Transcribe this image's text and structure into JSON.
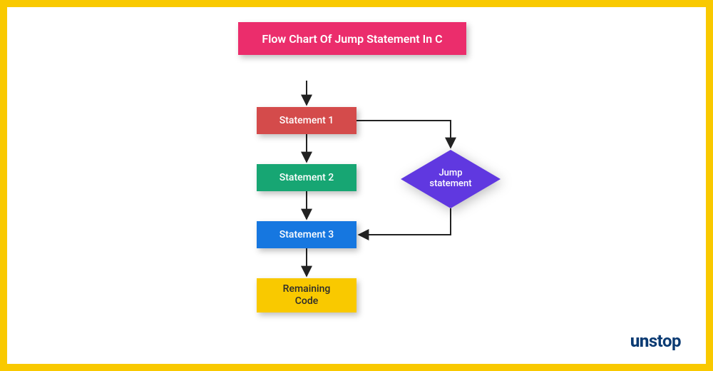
{
  "frame": {
    "border_color": "#f9c900"
  },
  "title": {
    "text": "Flow Chart Of Jump Statement In C",
    "bg": "#eb2d6c",
    "fg": "#ffffff"
  },
  "flow": {
    "stmt1": {
      "label": "Statement 1",
      "bg": "#d44b4b"
    },
    "stmt2": {
      "label": "Statement 2",
      "bg": "#17a673"
    },
    "stmt3": {
      "label": "Statement 3",
      "bg": "#1677e0"
    },
    "rem": {
      "label1": "Remaining",
      "label2": "Code",
      "bg": "#f9c900",
      "fg": "#2c2c2c"
    },
    "jump": {
      "label1": "Jump",
      "label2": "statement",
      "bg": "#6038e0"
    }
  },
  "arrow": {
    "stroke": "#222222"
  },
  "brand": {
    "text_accent": "un",
    "text_rest": "stop",
    "accent_color": "#0b3b73",
    "rest_color": "#0b3b73"
  }
}
